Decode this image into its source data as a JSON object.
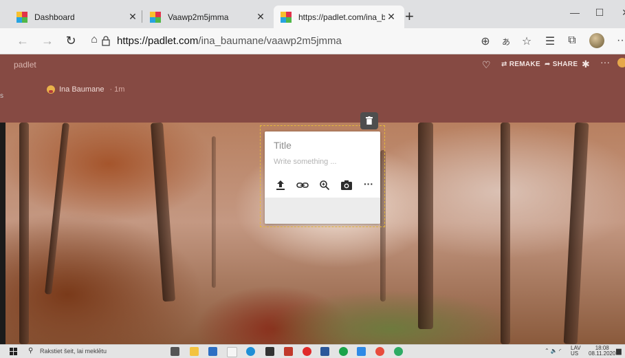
{
  "browser": {
    "tabs": [
      {
        "title": "Dashboard",
        "favicon": "padlet-icon",
        "active": false
      },
      {
        "title": "Vaawp2m5jmma",
        "favicon": "padlet-icon",
        "active": false
      },
      {
        "title": "https://padlet.com/ina_baumane",
        "favicon": "padlet-icon",
        "active": true
      }
    ],
    "new_tab": "+",
    "window_controls": {
      "minimize": "—",
      "maximize": "☐",
      "close": "✕"
    },
    "url_host": "https://padlet.com",
    "url_path": "/ina_baumane/vaawp2m5jmma",
    "overflow": "···"
  },
  "padlet": {
    "brand": "padlet",
    "header_buttons": {
      "remake": "REMAKE",
      "share": "SHARE"
    },
    "author": "Ina Baumane",
    "posted_ago": "1m",
    "colors": {
      "header": "#864a43",
      "selection": "#e4b83a"
    }
  },
  "post_card": {
    "title_placeholder": "Title",
    "body_placeholder": "Write something ...",
    "tools": [
      "upload-icon",
      "link-icon",
      "search-icon",
      "camera-icon",
      "more-icon"
    ]
  },
  "taskbar": {
    "search_placeholder": "Rakstiet šeit, lai meklētu",
    "language": "LAV",
    "language_sub": "US",
    "time": "18:08",
    "date": "08.11.2020"
  }
}
